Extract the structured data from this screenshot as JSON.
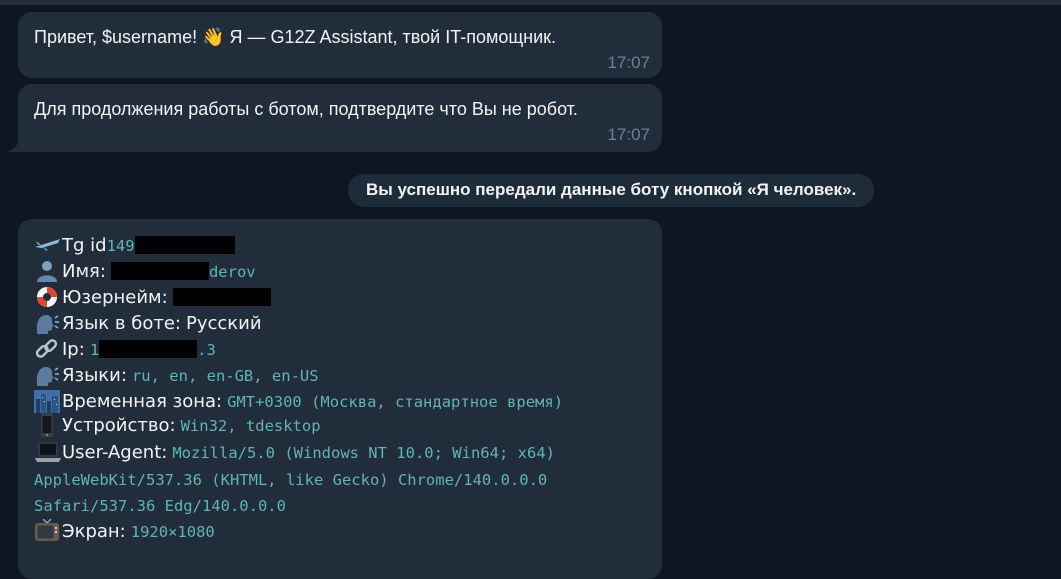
{
  "messages": {
    "greeting": {
      "text": "Привет, $username! 👋 Я — G12Z Assistant, твой IT-помощник.",
      "time": "17:07"
    },
    "verify": {
      "text": "Для продолжения работы с ботом, подтвердите что Вы не робот.",
      "time": "17:07"
    },
    "service": {
      "text": "Вы успешно передали данные боту кнопкой «Я человек»."
    }
  },
  "info": {
    "tg_id": {
      "label": "Tg id",
      "value": "149"
    },
    "name": {
      "label": "Имя:",
      "value": "derov"
    },
    "username": {
      "label": "Юзернейм:"
    },
    "bot_language": {
      "label": "Язык в боте:",
      "value": "Русский"
    },
    "ip": {
      "label": "Ip:",
      "value_start": "1",
      "value_end": ".3"
    },
    "languages": {
      "label": "Языки:",
      "value": "ru, en, en-GB, en-US"
    },
    "timezone": {
      "label": "Временная зона:",
      "value": "GMT+0300 (Москва, стандартное время)"
    },
    "device": {
      "label": "Устройство:",
      "value": "Win32, tdesktop"
    },
    "user_agent": {
      "label": "User-Agent:",
      "value_line1": "Mozilla/5.0 (Windows NT 10.0; Win64; x64)",
      "value_line2": "AppleWebKit/537.36 (KHTML, like Gecko) Chrome/140.0.0.0",
      "value_line3": "Safari/537.36 Edg/140.0.0.0"
    },
    "screen": {
      "label": "Экран:",
      "value": "1920×1080"
    }
  },
  "icons": {
    "tg_id": "airplane-icon",
    "name": "bust-silhouette-icon",
    "username": "lifebuoy-icon",
    "bot_language": "speaking-head-icon",
    "ip": "link-icon",
    "languages": "speaking-head-icon",
    "timezone": "cityscape-icon",
    "device": "mobile-phone-icon",
    "user_agent": "laptop-icon",
    "screen": "television-icon"
  },
  "colors": {
    "background": "#0e1621",
    "bubble": "#212d3b",
    "time": "#6b7f92",
    "mono_value": "#5fb6b3",
    "redaction": "#000000"
  }
}
